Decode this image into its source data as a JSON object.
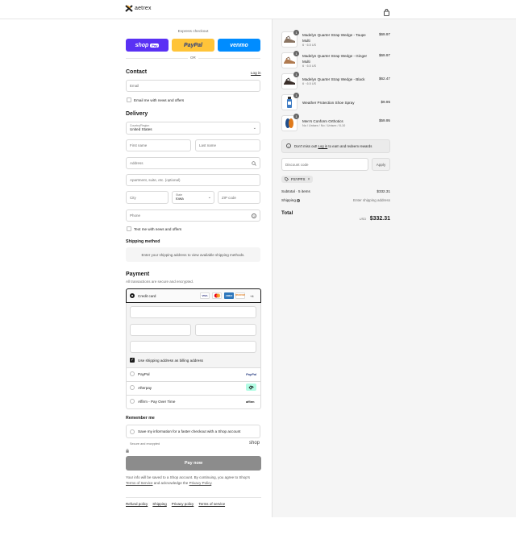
{
  "header": {
    "brand": "aetrex"
  },
  "express": {
    "title": "Express checkout",
    "shop_label": "shop",
    "shop_pay": "Pay",
    "paypal_label": "PayPal",
    "venmo_label": "venmo",
    "or": "OR"
  },
  "contact": {
    "title": "Contact",
    "login": "Log in",
    "email_placeholder": "Email",
    "news_label": "Email me with news and offers"
  },
  "delivery": {
    "title": "Delivery",
    "country_label": "Country/Region",
    "country_value": "United States",
    "first_name": "First name",
    "last_name": "Last name",
    "address": "Address",
    "apartment": "Apartment, suite, etc. (optional)",
    "city": "City",
    "state_label": "State",
    "state_value": "Iowa",
    "zip": "ZIP code",
    "phone": "Phone",
    "text_label": "Text me with news and offers"
  },
  "shipping": {
    "title": "Shipping method",
    "message": "Enter your shipping address to view available shipping methods."
  },
  "payment": {
    "title": "Payment",
    "subtitle": "All transactions are secure and encrypted.",
    "credit_card": "Credit card",
    "more_cards": "+4",
    "card_visa": "VISA",
    "card_amex": "AMEX",
    "card_discover": "DISCOVER",
    "billing_label": "Use shipping address as billing address",
    "paypal": "PayPal",
    "afterpay": "Afterpay",
    "affirm": "Affirm - Pay Over Time",
    "paypal_logo": "PayPal",
    "affirm_logo": "affirm"
  },
  "remember": {
    "title": "Remember me",
    "save_label": "Save my information for a faster checkout with a Shop account",
    "secure": "Secure and encrypted",
    "shop_logo": "shop"
  },
  "paynow": {
    "label": "Pay now"
  },
  "legal": {
    "text1": "Your info will be saved to a Shop account. By continuing, you agree to Shop's",
    "terms": "Terms of Service",
    "and": " and acknowledge the ",
    "privacy": "Privacy Policy",
    "dot": "."
  },
  "footer": {
    "links": [
      "Refund policy",
      "Shipping",
      "Privacy policy",
      "Terms of service"
    ]
  },
  "order": {
    "items": [
      {
        "name": "Madelyn Quarter Strap Wedge - Taupe Multi",
        "variant": "6 · 6.5 US",
        "price": "$69.97",
        "qty": "1"
      },
      {
        "name": "Madelyn Quarter Strap Wedge - Ginger Multi",
        "variant": "6 · 6.5 US",
        "price": "$69.97",
        "qty": "1"
      },
      {
        "name": "Madelyn Quarter Strap Wedge - Black",
        "variant": "6 · 6.5 US",
        "price": "$62.47",
        "qty": "1"
      },
      {
        "name": "Weather Protection Shoe Spray",
        "variant": "",
        "price": "$9.95",
        "qty": "1"
      },
      {
        "name": "Men's Conform Orthotics",
        "variant": "No / Unisex / No / Unisex / 8-10",
        "price": "$59.95",
        "qty": "1"
      }
    ],
    "rewards": {
      "pre": "Don't miss out! ",
      "login": "Log in",
      "post": " to earn and redeem rewards"
    },
    "discount_placeholder": "Discount code",
    "apply": "Apply",
    "code": "FSYPFX",
    "subtotal_label": "Subtotal · 5 items",
    "subtotal_value": "$332.31",
    "shipping_label": "Shipping",
    "shipping_value": "Enter shipping address",
    "total_label": "Total",
    "currency": "USD",
    "total_value": "$332.31"
  },
  "colors": {
    "shop_purple": "#5a31f4",
    "paypal_yellow": "#ffc439",
    "venmo_blue": "#008cff",
    "pay_gray": "#8c8c8c",
    "pane_bg": "#f5f5f5"
  }
}
